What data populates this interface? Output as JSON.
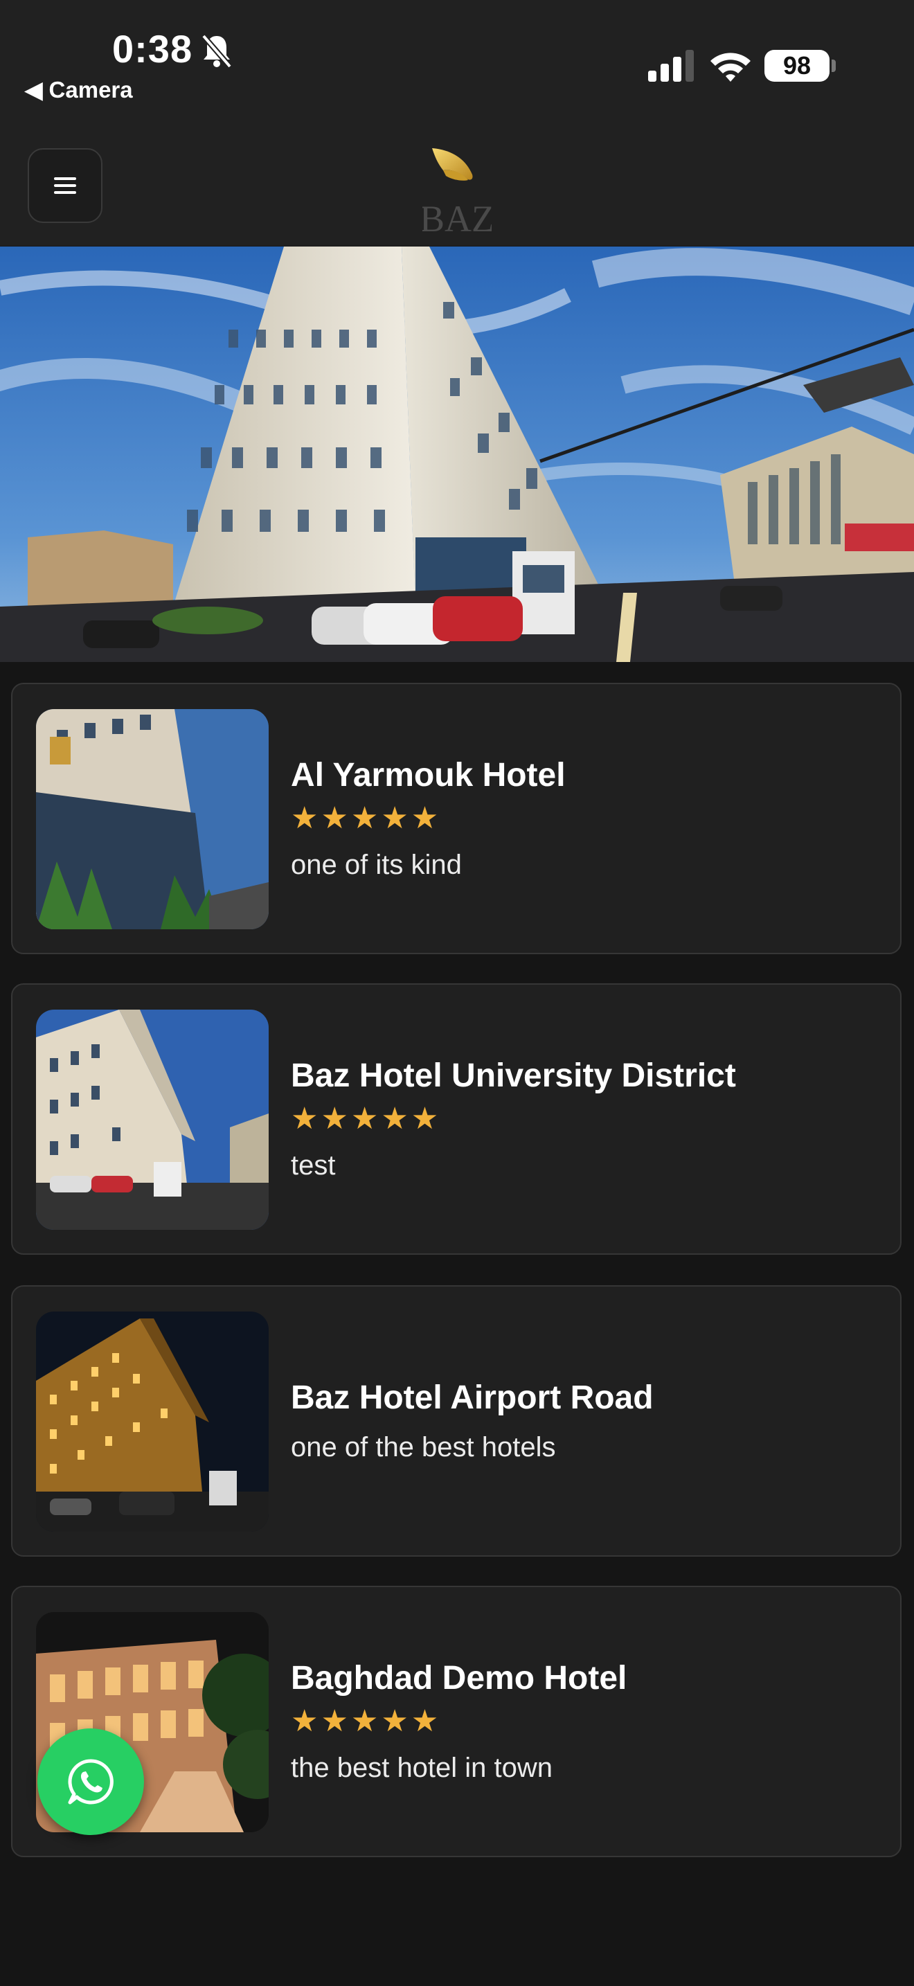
{
  "status_bar": {
    "time": "0:38",
    "back_label": "◀ Camera",
    "battery": "98"
  },
  "header": {
    "logo_text": "BAZ",
    "menu_icon": "hamburger-icon"
  },
  "hero": {
    "image": "hotel-building-photo"
  },
  "hotels": [
    {
      "name": "Al Yarmouk Hotel",
      "stars": "★★★★★",
      "rating": 5,
      "description": "one of its kind"
    },
    {
      "name": "Baz Hotel University District",
      "stars": "★★★★★",
      "rating": 5,
      "description": "test"
    },
    {
      "name": "Baz Hotel Airport Road",
      "stars": "",
      "rating": 0,
      "description": "one of the best hotels"
    },
    {
      "name": "Baghdad Demo Hotel",
      "stars": "★★★★★",
      "rating": 5,
      "description": "the best hotel in town"
    }
  ],
  "fab": {
    "icon": "whatsapp-icon"
  },
  "colors": {
    "accent_star": "#f2b13b",
    "whatsapp": "#27cf63",
    "background": "#151515",
    "card": "#202020"
  }
}
